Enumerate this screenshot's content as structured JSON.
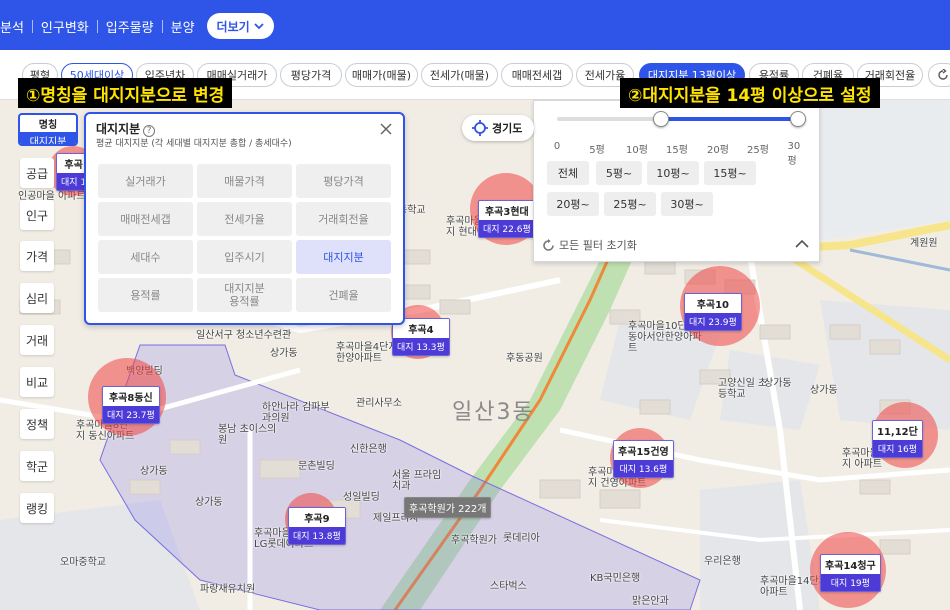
{
  "topnav": {
    "items": [
      "분석",
      "인구변화",
      "입주물량",
      "분양"
    ],
    "more_label": "더보기"
  },
  "chips": [
    {
      "label": "평형",
      "state": "normal"
    },
    {
      "label": "50세대이상",
      "state": "selected"
    },
    {
      "label": "입주년차",
      "state": "normal"
    },
    {
      "label": "매매실거래가",
      "state": "normal"
    },
    {
      "label": "평당가격",
      "state": "normal"
    },
    {
      "label": "매매가(매물)",
      "state": "normal"
    },
    {
      "label": "전세가(매물)",
      "state": "normal"
    },
    {
      "label": "매매전세갭",
      "state": "normal"
    },
    {
      "label": "전세가율",
      "state": "normal"
    },
    {
      "label": "대지지분 13평이상",
      "state": "active"
    },
    {
      "label": "용적률",
      "state": "normal"
    },
    {
      "label": "건폐율",
      "state": "normal"
    },
    {
      "label": "거래회전율",
      "state": "normal"
    }
  ],
  "annotations": {
    "left": "①명칭을 대지지분으로 변경",
    "right": "②대지지분을 14평 이상으로 설정"
  },
  "name_button": {
    "line1": "명칭",
    "line2": "대지지분"
  },
  "side_menu": [
    "공급",
    "인구",
    "가격",
    "심리",
    "거래",
    "비교",
    "정책",
    "학군",
    "랭킹"
  ],
  "panel": {
    "title": "대지지분",
    "help_icon": "?",
    "subtitle": "평균 대지지분 (각 세대별 대지지분 총합 / 총세대수)",
    "options": [
      {
        "label": "실거래가",
        "on": false
      },
      {
        "label": "매물가격",
        "on": false
      },
      {
        "label": "평당가격",
        "on": false
      },
      {
        "label": "매매전세갭",
        "on": false
      },
      {
        "label": "전세가율",
        "on": false
      },
      {
        "label": "거래회전율",
        "on": false
      },
      {
        "label": "세대수",
        "on": false
      },
      {
        "label": "입주시기",
        "on": false
      },
      {
        "label": "대지지분",
        "on": true
      },
      {
        "label": "용적률",
        "on": false
      },
      {
        "label": "대지지분\n용적률",
        "on": false
      },
      {
        "label": "건폐율",
        "on": false
      }
    ]
  },
  "slider": {
    "ticks": [
      "0",
      "5평",
      "10평",
      "15평",
      "20평",
      "25평",
      "30평"
    ],
    "range_min": 0,
    "range_max": 30,
    "selected_low": 13,
    "selected_high": 30,
    "buttons": [
      "전체",
      "5평~",
      "10평~",
      "15평~",
      "20평~",
      "25평~",
      "30평~"
    ],
    "reset_label": "모든 필터 초기화"
  },
  "gyeonggi_label": "경기도",
  "markers": [
    {
      "name": "후곡3현대",
      "area": "대지 22.6평"
    },
    {
      "name": "후곡10",
      "area": "대지 23.9평"
    },
    {
      "name": "후곡4",
      "area": "대지 13.3평"
    },
    {
      "name": "후곡8동신",
      "area": "대지 23.7평"
    },
    {
      "name": "후곡15건영",
      "area": "대지 13.6평"
    },
    {
      "name": "11,12단",
      "area": "대지 16평"
    },
    {
      "name": "후곡9",
      "area": "대지 13.8평"
    },
    {
      "name": "후곡14청구",
      "area": "대지 19평"
    },
    {
      "name": "후곡",
      "area": "대지 1"
    }
  ],
  "school_marker": {
    "label": "후곡학원가 222개"
  },
  "map_labels": [
    "일산서구 청소년수련관",
    "상가동",
    "후곡마을4단지 한양아파트",
    "후동공원",
    "관리사무소",
    "하안나라 김파부과의원",
    "봉남 초이스의원",
    "신한은행",
    "문촌빌딩",
    "서울 프라임치과",
    "성일빌딩",
    "제일프라자",
    "후곡학원가",
    "롯데리아",
    "스타벅스",
    "KB국민은행",
    "맑은안과",
    "파랑새유치원",
    "오마중학교",
    "상가동",
    "후곡마을9단지 LG롯데아파트",
    "후곡마을8단지 동신아파트",
    "백양빌딩",
    "후곡마을10단지 동아서안한양아파트",
    "고양신일 초등학교",
    "상가동",
    "상가동",
    "후곡마을15단지 건영아파트",
    "우리은행",
    "후곡마을14단지 청구아파트",
    "계원원",
    "후곡마을3단지 현대아파트",
    "동학교",
    "일산3동",
    "상가동",
    "후곡마을11단지 아파트",
    "인공마을 아파트"
  ]
}
